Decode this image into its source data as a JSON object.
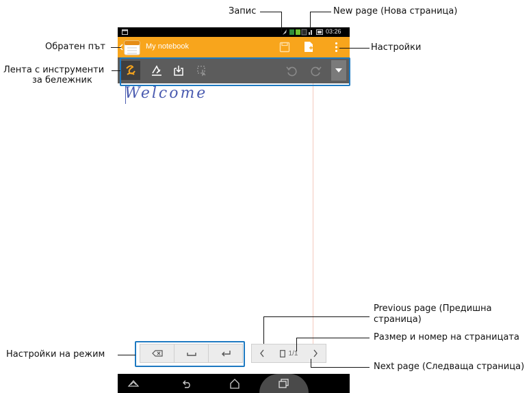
{
  "callouts": {
    "save": "Запис",
    "new_page": "New page (Нова страница)",
    "back": "Обратен път",
    "settings": "Настройки",
    "toolbar_line1": "Лента с инструменти",
    "toolbar_line2": "за бележник",
    "prev_page_line1": "Previous page (Предишна",
    "prev_page_line2": "страница)",
    "page_size_number": "Размер и номер на страницата",
    "mode_settings": "Настройки на режим",
    "next_page": "Next page (Следваща страница)"
  },
  "statusbar": {
    "time": "03:26"
  },
  "actionbar": {
    "title": "My notebook"
  },
  "page": {
    "text": "Welcome",
    "indicator": "1/1"
  },
  "colors": {
    "accent": "#f8a51c",
    "toolbar": "#5c5c5c",
    "highlight": "#1d79c1",
    "ink": "#4a5bb0"
  },
  "icons": {
    "toolbar": [
      "pen-icon",
      "eraser-icon",
      "insert-icon",
      "select-icon",
      "undo-icon",
      "redo-icon",
      "dropdown-icon"
    ],
    "mode": [
      "backspace-icon",
      "space-icon",
      "enter-icon"
    ],
    "nav": [
      "home-icon",
      "back-icon",
      "home-outline-icon",
      "recent-apps-icon"
    ]
  }
}
